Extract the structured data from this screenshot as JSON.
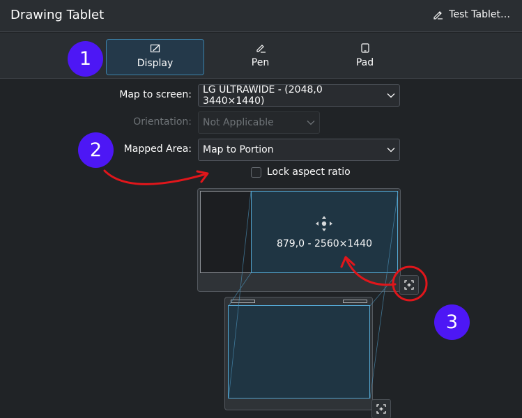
{
  "header": {
    "title": "Drawing Tablet",
    "test_tablet_label": "Test Tablet…"
  },
  "tabs": [
    {
      "label": "Display",
      "icon": "display-settings-icon",
      "active": true
    },
    {
      "label": "Pen",
      "icon": "pen-icon",
      "active": false
    },
    {
      "label": "Pad",
      "icon": "tablet-pad-icon",
      "active": false
    }
  ],
  "form": {
    "map_to_screen": {
      "label": "Map to screen:",
      "value": "LG ULTRAWIDE - (2048,0 3440×1440)"
    },
    "orientation": {
      "label": "Orientation:",
      "value": "Not Applicable",
      "disabled": true
    },
    "mapped_area": {
      "label": "Mapped Area:",
      "value": "Map to Portion"
    },
    "lock_aspect": {
      "label": "Lock aspect ratio",
      "checked": false
    }
  },
  "preview": {
    "monitor_area_text": "879,0 - 2560×1440",
    "move_icon": "move-arrows-icon",
    "fit_icon": "fit-area-icon"
  },
  "annotations": {
    "badge_1": "1",
    "badge_2": "2",
    "badge_3": "3",
    "badge_color": "#4d17f5",
    "arrow_color": "#e0161b"
  },
  "colors": {
    "accent": "#3d81a8",
    "highlight_border": "#55a8d3",
    "background": "#202326"
  }
}
